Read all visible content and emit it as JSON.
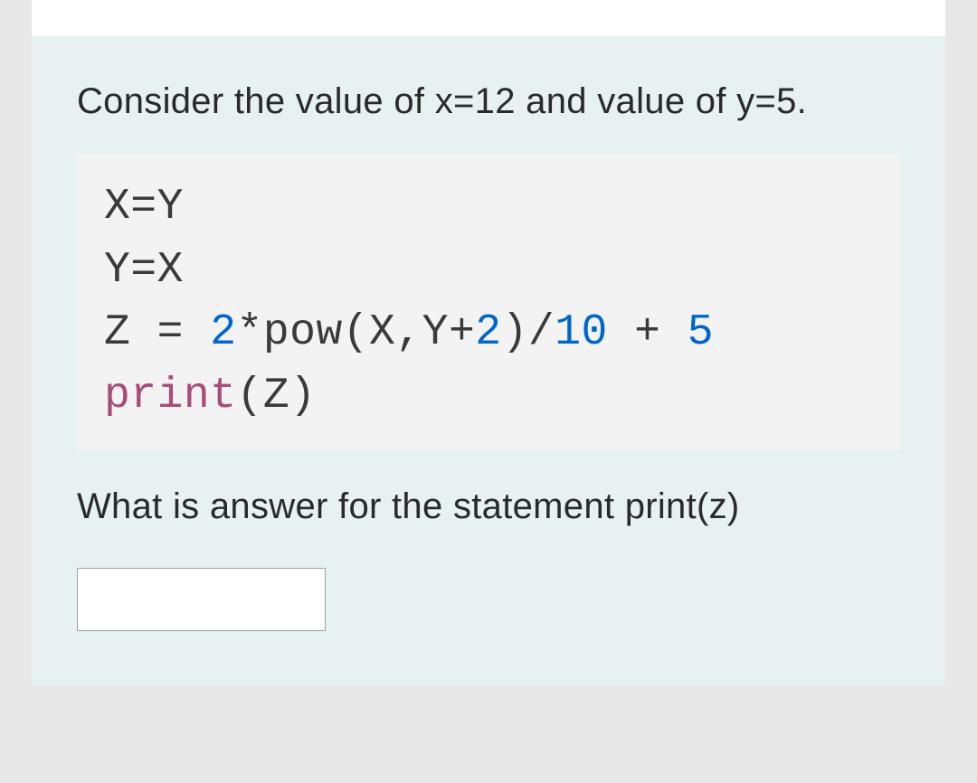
{
  "question": {
    "prompt": "Consider the value of x=12 and value of y=5.",
    "ask": "What is answer for the statement print(z)"
  },
  "code": {
    "line1": "X=Y",
    "line2": "Y=X",
    "line3_a": "Z = ",
    "line3_num1": "2",
    "line3_b": "*pow(X,Y+",
    "line3_num2": "2",
    "line3_c": ")/",
    "line3_num3": "10",
    "line3_d": " + ",
    "line3_num4": "5",
    "line4_func": "print",
    "line4_rest": "(Z)"
  },
  "answer": {
    "value": ""
  }
}
